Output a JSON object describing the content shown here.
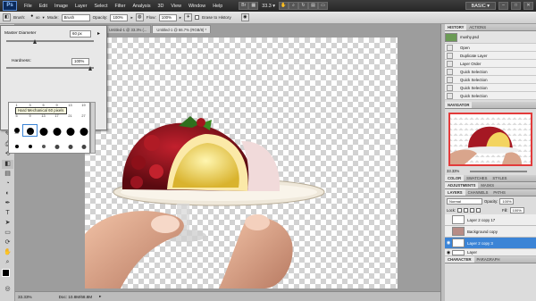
{
  "app": {
    "logo": "Ps",
    "workspace": "BASIC ▾",
    "zoom_menu": "33.3 ▾"
  },
  "menu": [
    "File",
    "Edit",
    "Image",
    "Layer",
    "Select",
    "Filter",
    "Analysis",
    "3D",
    "View",
    "Window",
    "Help"
  ],
  "options": {
    "brush_label": "Brush:",
    "brush_size": "60",
    "mode_label": "Mode:",
    "mode_value": "Brush",
    "opacity_label": "Opacity:",
    "opacity_value": "100%",
    "flow_label": "Flow:",
    "flow_value": "100%",
    "erase_history": "Erase to History"
  },
  "tabs": [
    "Untitled-1 @ 33.3% (...",
    "Untitled-1 @ 66.7% (RGB/8) *"
  ],
  "brush_popup": {
    "diameter_label": "Master Diameter",
    "diameter_value": "60 px",
    "hardness_label": "Hardness:",
    "hardness_value": "100%",
    "tooltip": "Hard Mechanical 60 pixels",
    "presets": [
      {
        "n": "1"
      },
      {
        "n": "3"
      },
      {
        "n": "5"
      },
      {
        "n": "9"
      },
      {
        "n": "13"
      },
      {
        "n": "19"
      },
      {
        "n": "5"
      },
      {
        "n": "9"
      },
      {
        "n": "13"
      },
      {
        "n": "17"
      },
      {
        "n": "21"
      },
      {
        "n": "27"
      },
      {
        "n": "35"
      },
      {
        "n": "45"
      },
      {
        "n": "65"
      },
      {
        "n": "100"
      },
      {
        "n": "200"
      },
      {
        "n": "300"
      },
      {
        "n": "9"
      },
      {
        "n": "13"
      },
      {
        "n": "19"
      },
      {
        "n": "17"
      },
      {
        "n": "45"
      },
      {
        "n": "65"
      }
    ]
  },
  "status": {
    "zoom": "33.33%",
    "doc": "Doc: 10.8M/68.8M"
  },
  "history": {
    "tabs": [
      "HISTORY",
      "ACTIONS"
    ],
    "snapshot": "mushy.psd",
    "steps": [
      "Open",
      "Duplicate Layer",
      "Layer Order",
      "Quick Selection",
      "Quick Selection",
      "Quick Selection",
      "Quick Selection"
    ]
  },
  "navigator": {
    "tab": "NAVIGATOR",
    "zoom": "33.33%"
  },
  "color_tabs": [
    "COLOR",
    "SWATCHES",
    "STYLES"
  ],
  "adj_tabs": [
    "ADJUSTMENTS",
    "MASKS"
  ],
  "layers": {
    "tabs": [
      "LAYERS",
      "CHANNELS",
      "PATHS"
    ],
    "blend": "Normal",
    "opacity_label": "Opacity:",
    "opacity": "100%",
    "lock_label": "Lock:",
    "fill_label": "Fill:",
    "fill": "100%",
    "items": [
      {
        "name": "Layer 2 copy 17"
      },
      {
        "name": "Background copy"
      },
      {
        "name": "Layer 2 copy 3"
      },
      {
        "name": "Layer"
      }
    ]
  },
  "bottom_tabs": [
    "CHARACTER",
    "PARAGRAPH"
  ],
  "colors": {
    "accent": "#3b84d6",
    "menubar": "#2e2e2e"
  }
}
